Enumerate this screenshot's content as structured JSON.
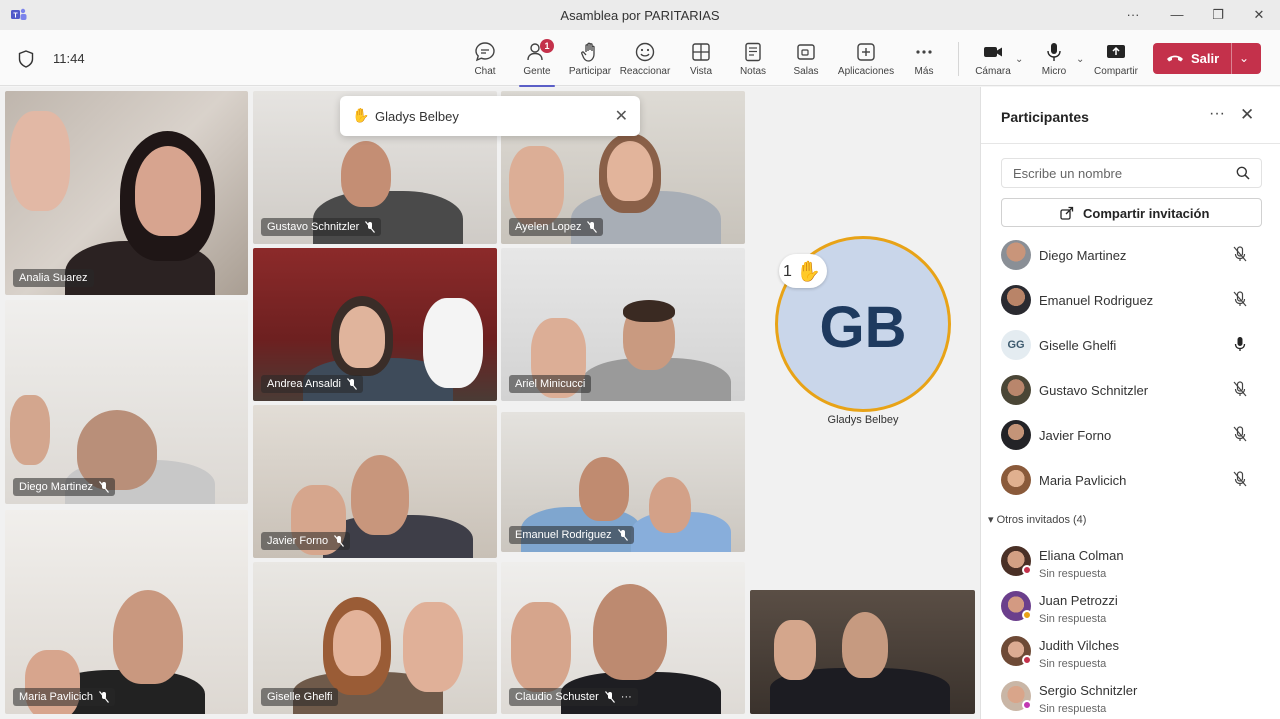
{
  "window": {
    "title": "Asamblea por PARITARIAS",
    "more_label": "···",
    "minimize_label": "—",
    "restore_label": "❐",
    "close_label": "✕"
  },
  "toolbar": {
    "time": "11:44",
    "people_badge": "1",
    "items": [
      {
        "id": "chat",
        "label": "Chat"
      },
      {
        "id": "people",
        "label": "Gente"
      },
      {
        "id": "raise",
        "label": "Participar"
      },
      {
        "id": "react",
        "label": "Reaccionar"
      },
      {
        "id": "view",
        "label": "Vista"
      },
      {
        "id": "notes",
        "label": "Notas"
      },
      {
        "id": "rooms",
        "label": "Salas"
      },
      {
        "id": "apps",
        "label": "Aplicaciones"
      },
      {
        "id": "more",
        "label": "Más"
      },
      {
        "id": "camera",
        "label": "Cámara"
      },
      {
        "id": "mic",
        "label": "Micro"
      },
      {
        "id": "share",
        "label": "Compartir"
      }
    ],
    "leave_label": "Salir",
    "accent_color": "#5b5fc7",
    "leave_color": "#c4314b"
  },
  "stage": {
    "tiles": [
      {
        "name": "Analia Suarez",
        "muted": false
      },
      {
        "name": "Gustavo Schnitzler",
        "muted": true
      },
      {
        "name": "Ayelen Lopez",
        "muted": true
      },
      {
        "name": "Diego Martinez",
        "muted": true
      },
      {
        "name": "Andrea Ansaldi",
        "muted": true
      },
      {
        "name": "Ariel Minicucci",
        "muted": false
      },
      {
        "name": "Maria Pavlicich",
        "muted": true
      },
      {
        "name": "Javier Forno",
        "muted": true
      },
      {
        "name": "Emanuel Rodriguez",
        "muted": true
      },
      {
        "name": "Giselle Ghelfi",
        "muted": false
      },
      {
        "name": "Claudio Schuster",
        "muted": true
      }
    ],
    "toast": {
      "hand": "✋",
      "name": "Gladys Belbey",
      "close": "✕"
    },
    "raised": {
      "initials": "GB",
      "count": "1",
      "hand": "✋",
      "name": "Gladys Belbey"
    },
    "tile_more": "···"
  },
  "panel": {
    "title": "Participantes",
    "more": "···",
    "close": "✕",
    "search_placeholder": "Escribe un nombre",
    "invite_label": "Compartir invitación",
    "participants": [
      {
        "name": "Diego Martinez",
        "mic": "muted"
      },
      {
        "name": "Emanuel Rodriguez",
        "mic": "muted"
      },
      {
        "name": "Giselle Ghelfi",
        "initials": "GG",
        "mic": "on"
      },
      {
        "name": "Gustavo Schnitzler",
        "mic": "muted"
      },
      {
        "name": "Javier Forno",
        "mic": "muted"
      },
      {
        "name": "Maria Pavlicich",
        "mic": "muted"
      }
    ],
    "others_label": "Otros invitados (4)",
    "others": [
      {
        "name": "Eliana Colman",
        "status": "Sin respuesta"
      },
      {
        "name": "Juan Petrozzi",
        "status": "Sin respuesta"
      },
      {
        "name": "Judith Vilches",
        "status": "Sin respuesta"
      },
      {
        "name": "Sergio Schnitzler",
        "status": "Sin respuesta"
      }
    ]
  }
}
